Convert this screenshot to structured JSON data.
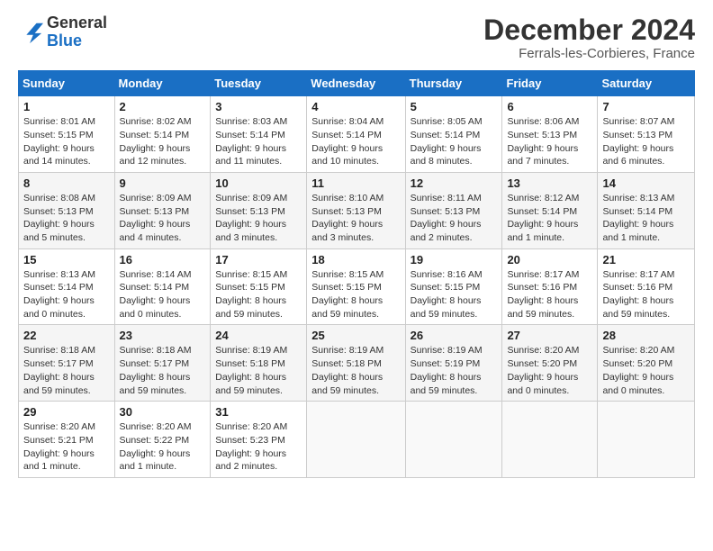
{
  "header": {
    "logo_general": "General",
    "logo_blue": "Blue",
    "month_title": "December 2024",
    "location": "Ferrals-les-Corbieres, France"
  },
  "weekdays": [
    "Sunday",
    "Monday",
    "Tuesday",
    "Wednesday",
    "Thursday",
    "Friday",
    "Saturday"
  ],
  "weeks": [
    [
      {
        "day": "1",
        "info": "Sunrise: 8:01 AM\nSunset: 5:15 PM\nDaylight: 9 hours and 14 minutes."
      },
      {
        "day": "2",
        "info": "Sunrise: 8:02 AM\nSunset: 5:14 PM\nDaylight: 9 hours and 12 minutes."
      },
      {
        "day": "3",
        "info": "Sunrise: 8:03 AM\nSunset: 5:14 PM\nDaylight: 9 hours and 11 minutes."
      },
      {
        "day": "4",
        "info": "Sunrise: 8:04 AM\nSunset: 5:14 PM\nDaylight: 9 hours and 10 minutes."
      },
      {
        "day": "5",
        "info": "Sunrise: 8:05 AM\nSunset: 5:14 PM\nDaylight: 9 hours and 8 minutes."
      },
      {
        "day": "6",
        "info": "Sunrise: 8:06 AM\nSunset: 5:13 PM\nDaylight: 9 hours and 7 minutes."
      },
      {
        "day": "7",
        "info": "Sunrise: 8:07 AM\nSunset: 5:13 PM\nDaylight: 9 hours and 6 minutes."
      }
    ],
    [
      {
        "day": "8",
        "info": "Sunrise: 8:08 AM\nSunset: 5:13 PM\nDaylight: 9 hours and 5 minutes."
      },
      {
        "day": "9",
        "info": "Sunrise: 8:09 AM\nSunset: 5:13 PM\nDaylight: 9 hours and 4 minutes."
      },
      {
        "day": "10",
        "info": "Sunrise: 8:09 AM\nSunset: 5:13 PM\nDaylight: 9 hours and 3 minutes."
      },
      {
        "day": "11",
        "info": "Sunrise: 8:10 AM\nSunset: 5:13 PM\nDaylight: 9 hours and 3 minutes."
      },
      {
        "day": "12",
        "info": "Sunrise: 8:11 AM\nSunset: 5:13 PM\nDaylight: 9 hours and 2 minutes."
      },
      {
        "day": "13",
        "info": "Sunrise: 8:12 AM\nSunset: 5:14 PM\nDaylight: 9 hours and 1 minute."
      },
      {
        "day": "14",
        "info": "Sunrise: 8:13 AM\nSunset: 5:14 PM\nDaylight: 9 hours and 1 minute."
      }
    ],
    [
      {
        "day": "15",
        "info": "Sunrise: 8:13 AM\nSunset: 5:14 PM\nDaylight: 9 hours and 0 minutes."
      },
      {
        "day": "16",
        "info": "Sunrise: 8:14 AM\nSunset: 5:14 PM\nDaylight: 9 hours and 0 minutes."
      },
      {
        "day": "17",
        "info": "Sunrise: 8:15 AM\nSunset: 5:15 PM\nDaylight: 8 hours and 59 minutes."
      },
      {
        "day": "18",
        "info": "Sunrise: 8:15 AM\nSunset: 5:15 PM\nDaylight: 8 hours and 59 minutes."
      },
      {
        "day": "19",
        "info": "Sunrise: 8:16 AM\nSunset: 5:15 PM\nDaylight: 8 hours and 59 minutes."
      },
      {
        "day": "20",
        "info": "Sunrise: 8:17 AM\nSunset: 5:16 PM\nDaylight: 8 hours and 59 minutes."
      },
      {
        "day": "21",
        "info": "Sunrise: 8:17 AM\nSunset: 5:16 PM\nDaylight: 8 hours and 59 minutes."
      }
    ],
    [
      {
        "day": "22",
        "info": "Sunrise: 8:18 AM\nSunset: 5:17 PM\nDaylight: 8 hours and 59 minutes."
      },
      {
        "day": "23",
        "info": "Sunrise: 8:18 AM\nSunset: 5:17 PM\nDaylight: 8 hours and 59 minutes."
      },
      {
        "day": "24",
        "info": "Sunrise: 8:19 AM\nSunset: 5:18 PM\nDaylight: 8 hours and 59 minutes."
      },
      {
        "day": "25",
        "info": "Sunrise: 8:19 AM\nSunset: 5:18 PM\nDaylight: 8 hours and 59 minutes."
      },
      {
        "day": "26",
        "info": "Sunrise: 8:19 AM\nSunset: 5:19 PM\nDaylight: 8 hours and 59 minutes."
      },
      {
        "day": "27",
        "info": "Sunrise: 8:20 AM\nSunset: 5:20 PM\nDaylight: 9 hours and 0 minutes."
      },
      {
        "day": "28",
        "info": "Sunrise: 8:20 AM\nSunset: 5:20 PM\nDaylight: 9 hours and 0 minutes."
      }
    ],
    [
      {
        "day": "29",
        "info": "Sunrise: 8:20 AM\nSunset: 5:21 PM\nDaylight: 9 hours and 1 minute."
      },
      {
        "day": "30",
        "info": "Sunrise: 8:20 AM\nSunset: 5:22 PM\nDaylight: 9 hours and 1 minute."
      },
      {
        "day": "31",
        "info": "Sunrise: 8:20 AM\nSunset: 5:23 PM\nDaylight: 9 hours and 2 minutes."
      },
      null,
      null,
      null,
      null
    ]
  ]
}
